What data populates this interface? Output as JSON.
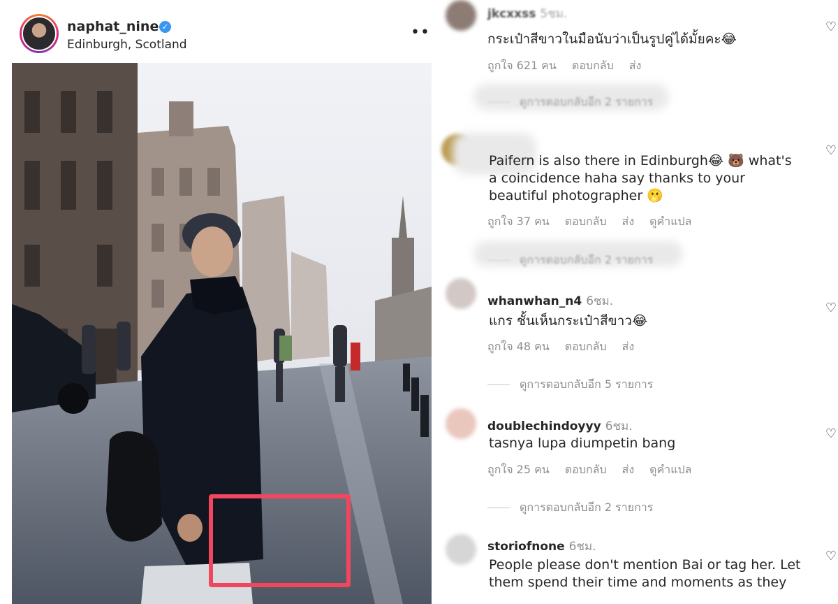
{
  "post": {
    "username": "naphat_nine",
    "location": "Edinburgh, Scotland",
    "verified_glyph": "✓",
    "more_glyph": "•••",
    "icons": [
      "verified-badge-icon",
      "more-options-icon"
    ],
    "highlight_color": "#f0475f"
  },
  "comments": [
    {
      "user": "jkcxxss",
      "time": "5ชม.",
      "text": "กระเป๋าสีขาวในมือนับว่าเป็นรูปคู่ได้มั้ยคะ😂",
      "likes": "ถูกใจ 621 คน",
      "reply": "ตอบกลับ",
      "send": "ส่ง",
      "translate": ""
    },
    {
      "user": "",
      "time": "",
      "text": "Paifern is also there in Edinburgh😂 🐻 what's\na coincidence haha say thanks to your\nbeautiful photographer 🫢",
      "likes": "ถูกใจ 37 คน",
      "reply": "ตอบกลับ",
      "send": "ส่ง",
      "translate": "ดูคำแปล"
    },
    {
      "user": "whanwhan_n4",
      "time": "6ชม.",
      "text": "แกร ชั้นเห็นกระเป๋าสีขาว😂",
      "likes": "ถูกใจ 48 คน",
      "reply": "ตอบกลับ",
      "send": "ส่ง",
      "translate": ""
    },
    {
      "user": "doublechindoyyy",
      "time": "6ชม.",
      "text": "tasnya lupa diumpetin bang",
      "likes": "ถูกใจ 25 คน",
      "reply": "ตอบกลับ",
      "send": "ส่ง",
      "translate": "ดูคำแปล"
    },
    {
      "user": "storiofnone",
      "time": "6ชม.",
      "text": "People please don't mention Bai or tag her. Let\nthem spend their time and moments as they",
      "likes": "",
      "reply": "",
      "send": "",
      "translate": ""
    }
  ],
  "reply_threads": [
    "ดูการตอบกลับอีก 2 รายการ",
    "ดูการตอบกลับอีก 5 รายการ",
    "ดูการตอบกลับอีก 2 รายการ"
  ],
  "heart_glyph": "♡"
}
